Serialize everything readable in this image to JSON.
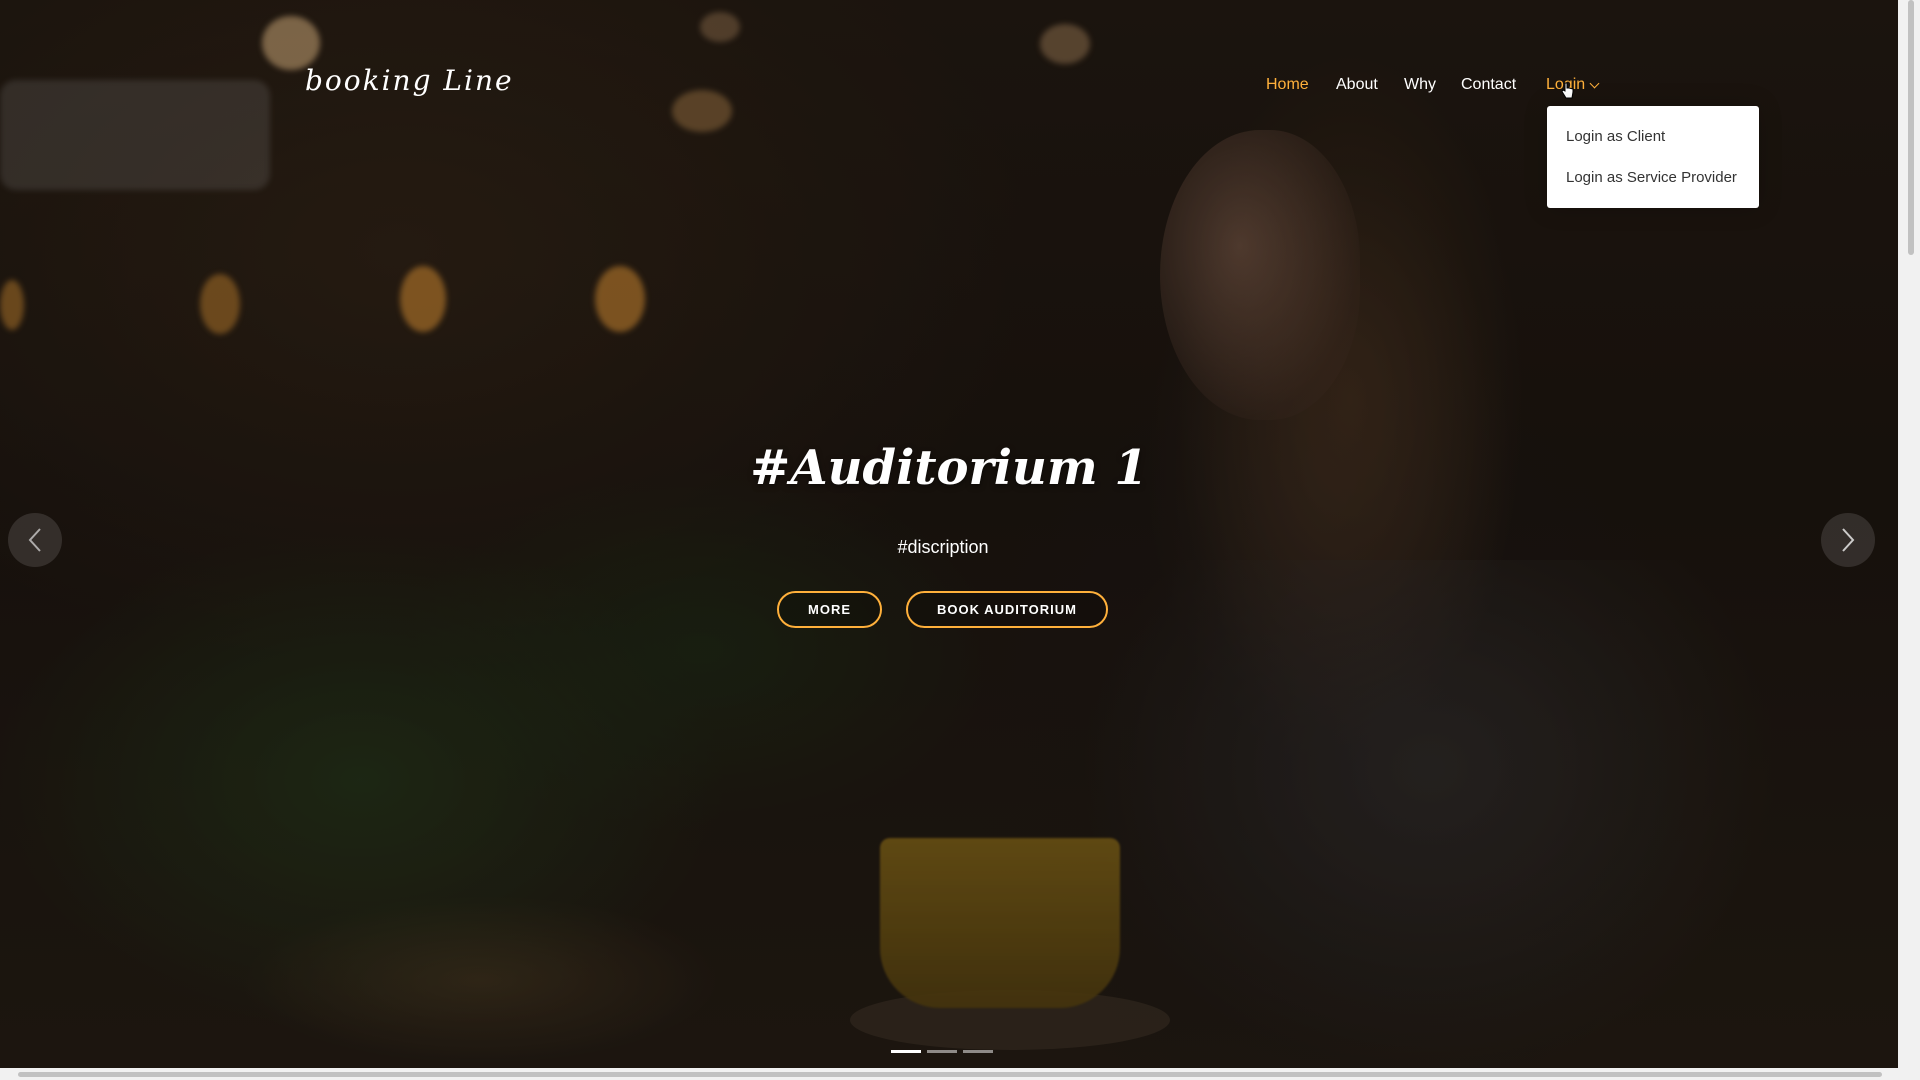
{
  "brand": {
    "name": "booking Line"
  },
  "nav": {
    "items": [
      {
        "label": "Home",
        "active": true
      },
      {
        "label": "About"
      },
      {
        "label": "Why"
      },
      {
        "label": "Contact"
      },
      {
        "label": "Login",
        "has_dropdown": true
      }
    ],
    "login_dropdown": {
      "items": [
        "Login as Client",
        "Login as Service Provider"
      ]
    }
  },
  "hero": {
    "title": "#Auditorium 1",
    "description": "#discription",
    "buttons": {
      "more": "MORE",
      "book": "BOOK AUDITORIUM"
    },
    "slide_count": 3,
    "active_slide": 1
  },
  "colors": {
    "accent": "#ffb03b",
    "text": "#ffffff",
    "dropdown_bg": "#ffffff",
    "dropdown_text": "#333333"
  },
  "icons": {
    "prev": "chevron-left-icon",
    "next": "chevron-right-icon",
    "dropdown": "chevron-down-icon",
    "cursor": "hand-pointer-icon"
  }
}
